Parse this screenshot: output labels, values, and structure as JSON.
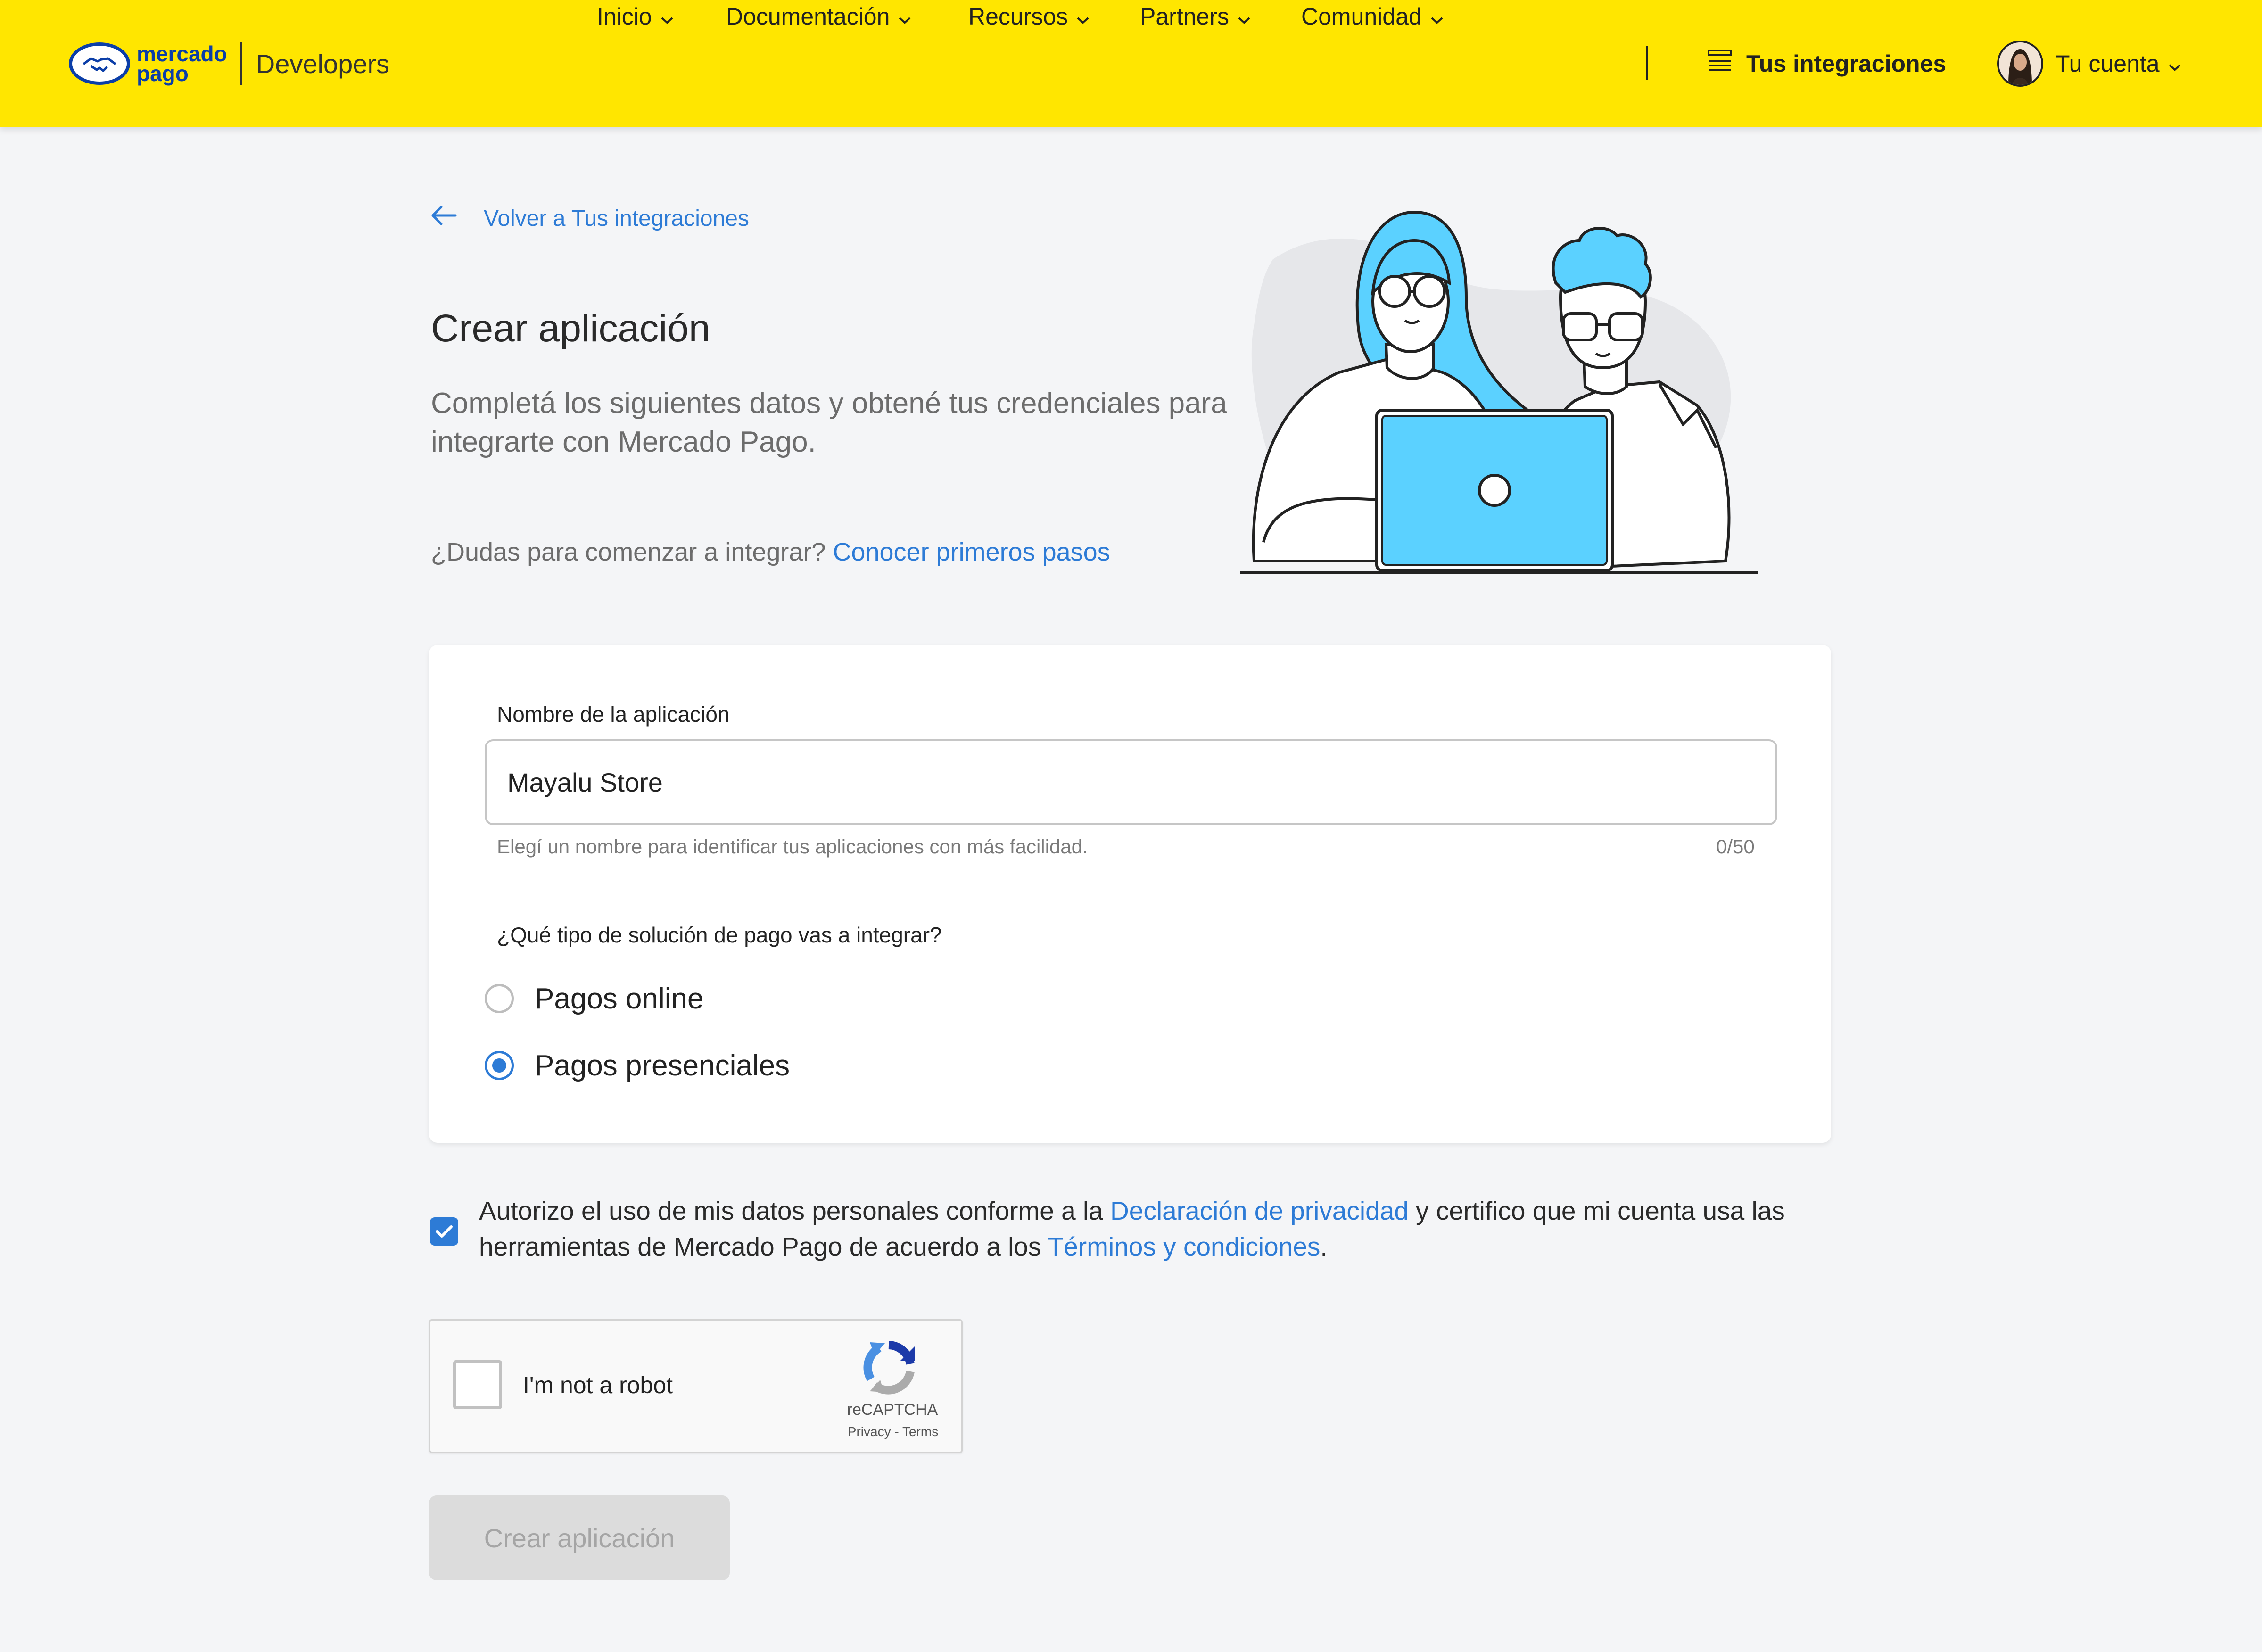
{
  "brand": {
    "logo_line1": "mercado",
    "logo_line2": "pago",
    "section": "Developers"
  },
  "nav": {
    "items": [
      {
        "label": "Inicio",
        "icon": "chevron-down-icon"
      },
      {
        "label": "Documentación",
        "icon": "chevron-down-icon"
      },
      {
        "label": "Recursos",
        "icon": "chevron-down-icon"
      },
      {
        "label": "Partners",
        "icon": "chevron-down-icon"
      },
      {
        "label": "Comunidad",
        "icon": "chevron-down-icon"
      }
    ],
    "integrations_label": "Tus integraciones",
    "integrations_icon": "list-icon",
    "account_label": "Tu cuenta"
  },
  "intro": {
    "back_label": "Volver a Tus integraciones",
    "title": "Crear aplicación",
    "subtitle": "Completá los siguientes datos y obtené tus credenciales para integrarte con Mercado Pago.",
    "doubts_text": "¿Dudas para comenzar a integrar?",
    "doubts_link": "Conocer primeros pasos"
  },
  "form": {
    "name_label": "Nombre de la aplicación",
    "name_value": "Mayalu Store",
    "name_helper": "Elegí un nombre para identificar tus aplicaciones con más facilidad.",
    "name_counter": "0/50",
    "solution_question": "¿Qué tipo de solución de pago vas a integrar?",
    "options": [
      {
        "label": "Pagos online",
        "checked": false
      },
      {
        "label": "Pagos presenciales",
        "checked": true
      }
    ]
  },
  "consent": {
    "checked": true,
    "text_before": "Autorizo el uso de mis datos personales conforme a la ",
    "privacy_link": "Declaración de privacidad",
    "text_middle": " y certifico que mi cuenta usa las herramientas de Mercado Pago de acuerdo a los ",
    "terms_link": "Términos y condiciones",
    "text_after": "."
  },
  "captcha": {
    "label": "I'm not a robot",
    "brand": "reCAPTCHA",
    "privacy": "Privacy",
    "separator": " - ",
    "terms": "Terms"
  },
  "submit_label": "Crear aplicación",
  "colors": {
    "topbar": "#ffe600",
    "link": "#2d7bd6",
    "illustration_accent": "#5bd1ff",
    "disabled_button": "#dcdcdc"
  }
}
